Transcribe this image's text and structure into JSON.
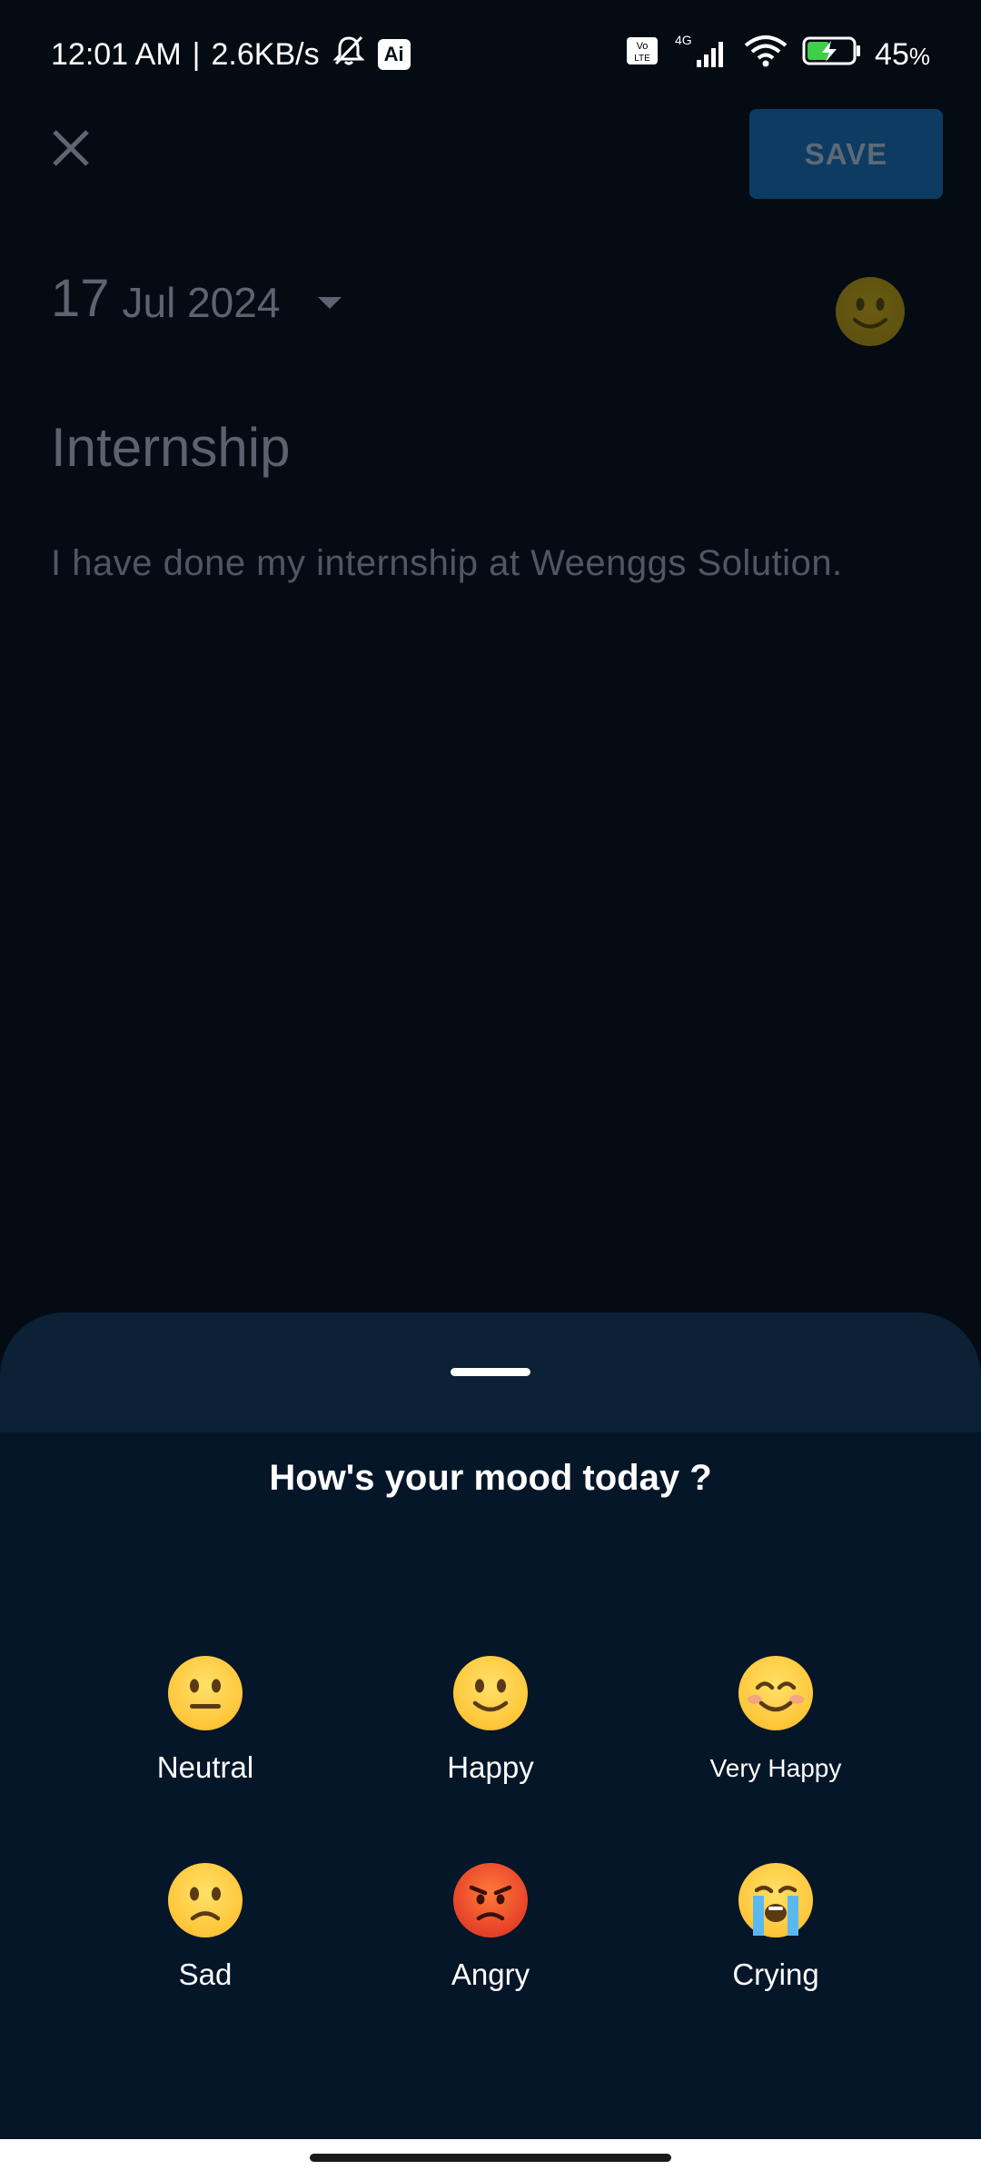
{
  "status_bar": {
    "time": "12:01 AM",
    "net_speed": "2.6KB/s",
    "ai_label": "Ai",
    "battery": "45",
    "battery_unit": "%",
    "network": "4G"
  },
  "toolbar": {
    "save_label": "SAVE"
  },
  "entry": {
    "day": "17",
    "month_year": "Jul 2024",
    "title": "Internship",
    "body": "I have done my internship at Weenggs Solution."
  },
  "sheet": {
    "title": "How's your mood today ?",
    "moods": [
      {
        "label": "Neutral",
        "icon": "neutral-face-icon"
      },
      {
        "label": "Happy",
        "icon": "slightly-smiling-face-icon"
      },
      {
        "label": "Very Happy",
        "icon": "smiling-face-icon"
      },
      {
        "label": "Sad",
        "icon": "sad-face-icon"
      },
      {
        "label": "Angry",
        "icon": "angry-face-icon"
      },
      {
        "label": "Crying",
        "icon": "crying-face-icon"
      }
    ]
  },
  "colors": {
    "background": "#040b13",
    "sheet": "#061629",
    "save_button": "#0e3b61"
  }
}
